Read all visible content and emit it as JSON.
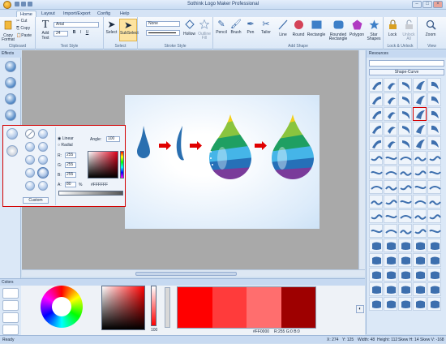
{
  "app": {
    "title": "Sothink Logo Maker Professional"
  },
  "tabs": [
    {
      "label": "Home",
      "active": true
    },
    {
      "label": "Layout",
      "active": false
    },
    {
      "label": "Import/Export",
      "active": false
    },
    {
      "label": "Config",
      "active": false
    },
    {
      "label": "Help",
      "active": false
    }
  ],
  "ribbon": {
    "groups": {
      "clipboard": "Clipboard",
      "text_style": "Text Style",
      "select": "Select",
      "stroke_style": "Stroke Style",
      "add_shape": "Add Shape",
      "lock_unlock": "Lock & Unlock",
      "view": "View"
    },
    "copy_format": "Copy Format",
    "cut": "Cut",
    "copy": "Copy",
    "paste": "Paste",
    "add_text": "Add Text",
    "font_name": "Arial",
    "font_size": "24",
    "bold": "B",
    "italic": "I",
    "underline": "U",
    "select": "Select",
    "subselect": "SubSelect",
    "stroke_style_value": "None",
    "hollow": "Hollow",
    "outline_fill": "Outline Fill",
    "pencil": "Pencil",
    "brush": "Brush",
    "pen": "Pen",
    "tailor": "Tailor",
    "line": "Line",
    "round": "Round",
    "rectangle": "Rectangle",
    "rounded_rectangle": "Rounded Rectangle",
    "polygon": "Polygon",
    "star_shapes": "Star Shapes",
    "lock": "Lock",
    "unlock_all": "Unlock All",
    "zoom": "Zoom"
  },
  "effects": {
    "header": "Effects"
  },
  "fill_panel": {
    "linear": "Linear",
    "radial": "Radial",
    "angle_label": "Angle:",
    "angle_value": "100",
    "r_label": "R:",
    "r_value": "255",
    "g_label": "G:",
    "g_value": "255",
    "b_label": "B:",
    "b_value": "255",
    "a_label": "A:",
    "a_value": "80",
    "percent": "%",
    "hex_value": "#FFFFFF",
    "custom": "Custom"
  },
  "resources": {
    "header": "Resources",
    "category": "Shape-Curve"
  },
  "colors": {
    "header": "Colors",
    "hex": "#FF0000",
    "r_label": "R:",
    "r_value": "255",
    "g_label": "G:",
    "g_value": "0",
    "b_label": "B:",
    "b_value": "0",
    "alpha_value": "100",
    "palette": [
      "#ff0000",
      "#ff3b3b",
      "#ff6e6e",
      "#9e0000"
    ]
  },
  "status": {
    "ready": "Ready",
    "x": "X: 274",
    "y": "Y: 125",
    "width": "Width: 48",
    "height": "Height: 112",
    "skew_h": "Skew H: 14",
    "skew_v": "Skew V: -168"
  }
}
